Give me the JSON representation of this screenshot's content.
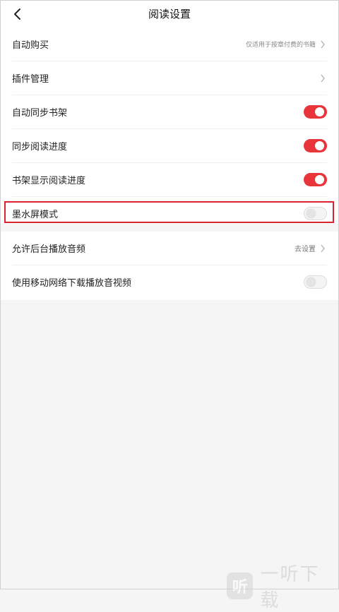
{
  "header": {
    "title": "阅读设置",
    "back_icon": "chevron-left-icon"
  },
  "settings": [
    {
      "label": "自动购买",
      "hint": "仅适用于按章付费的书籍",
      "control": "chevron"
    },
    {
      "label": "插件管理",
      "control": "chevron"
    },
    {
      "label": "自动同步书架",
      "control": "toggle",
      "state": "on"
    },
    {
      "label": "同步阅读进度",
      "control": "toggle",
      "state": "on"
    },
    {
      "label": "书架显示阅读进度",
      "control": "toggle",
      "state": "on"
    },
    {
      "label": "墨水屏模式",
      "control": "toggle",
      "state": "off",
      "highlighted": true
    }
  ],
  "settings2": [
    {
      "label": "允许后台播放音频",
      "hint": "去设置",
      "control": "chevron"
    },
    {
      "label": "使用移动网络下载播放音视频",
      "control": "toggle",
      "state": "off"
    }
  ],
  "watermark": {
    "logo_char": "听",
    "text": "一听下载"
  },
  "colors": {
    "toggle_on": "#e8353a",
    "highlight_border": "#d9242f",
    "background": "#f5f5f5"
  }
}
